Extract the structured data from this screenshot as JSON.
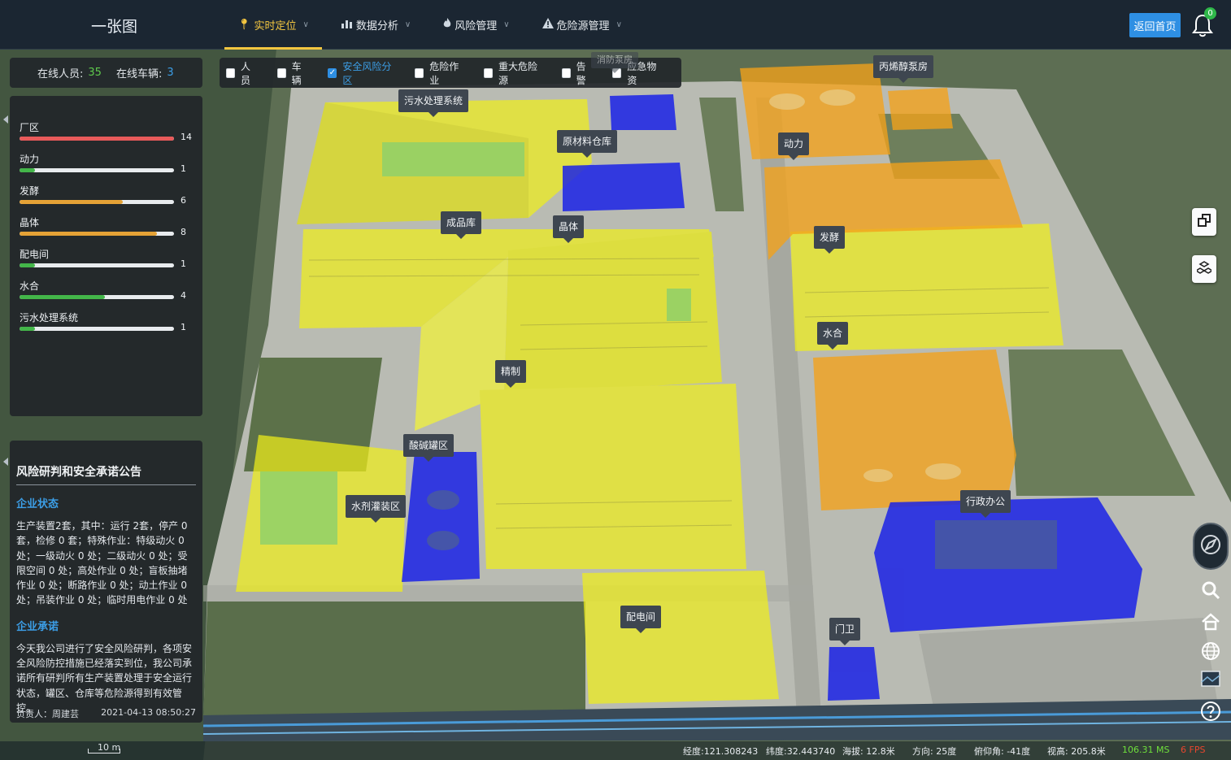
{
  "header": {
    "app_title": "一张图",
    "nav": [
      {
        "label": "实时定位",
        "active": true
      },
      {
        "label": "数据分析",
        "active": false
      },
      {
        "label": "风险管理",
        "active": false
      },
      {
        "label": "危险源管理",
        "active": false
      }
    ],
    "home_button": "返回首页",
    "notification_count": "0"
  },
  "online": {
    "staff_label": "在线人员:",
    "staff_count": "35",
    "vehicle_label": "在线车辆:",
    "vehicle_count": "3"
  },
  "filters": [
    {
      "label": "人员",
      "checked": false
    },
    {
      "label": "车辆",
      "checked": false
    },
    {
      "label": "安全风险分区",
      "checked": true
    },
    {
      "label": "危险作业",
      "checked": false
    },
    {
      "label": "重大危险源",
      "checked": false
    },
    {
      "label": "告警",
      "checked": false
    },
    {
      "label": "应急物资",
      "checked": false
    }
  ],
  "zones": [
    {
      "name": "厂区",
      "value": "14",
      "ratio": 1.0,
      "color": "#e85a5a"
    },
    {
      "name": "动力",
      "value": "1",
      "ratio": 0.1,
      "color": "#43b649"
    },
    {
      "name": "发酵",
      "value": "6",
      "ratio": 0.67,
      "color": "#e5a236"
    },
    {
      "name": "晶体",
      "value": "8",
      "ratio": 0.89,
      "color": "#e5a236"
    },
    {
      "name": "配电间",
      "value": "1",
      "ratio": 0.1,
      "color": "#43b649"
    },
    {
      "name": "水合",
      "value": "4",
      "ratio": 0.55,
      "color": "#43b649"
    },
    {
      "name": "污水处理系统",
      "value": "1",
      "ratio": 0.1,
      "color": "#43b649"
    }
  ],
  "notice": {
    "title": "风险研判和安全承诺公告",
    "status_heading": "企业状态",
    "status_text": "生产装置2套，其中：运行 2套，停产 0 套，检修 0 套；特殊作业：特级动火 0 处；一级动火 0 处；二级动火 0 处；受限空间 0 处；高处作业 0 处；盲板抽堵作业 0 处；断路作业 0 处；动土作业 0 处；吊装作业 0 处；临时用电作业 0 处",
    "promise_heading": "企业承诺",
    "promise_text": "今天我公司进行了安全风险研判，各项安全风险防控措施已经落实到位，我公司承诺所有研判所有生产装置处理于安全运行状态，罐区、仓库等危险源得到有效管控。",
    "owner": "负责人：周建芸",
    "datetime": "2021-04-13 08:50:27"
  },
  "buildings": [
    {
      "name": "污水处理系统"
    },
    {
      "name": "原材料仓库"
    },
    {
      "name": "丙烯醇泵房"
    },
    {
      "name": "消防泵房"
    },
    {
      "name": "动力"
    },
    {
      "name": "成品库"
    },
    {
      "name": "晶体"
    },
    {
      "name": "发酵"
    },
    {
      "name": "水合"
    },
    {
      "name": "精制"
    },
    {
      "name": "酸碱罐区"
    },
    {
      "name": "水剂灌装区"
    },
    {
      "name": "行政办公"
    },
    {
      "name": "配电间"
    },
    {
      "name": "门卫"
    }
  ],
  "statusbar": {
    "scale": "10 m",
    "longitude": "经度:121.308243",
    "latitude": "纬度:32.443740",
    "altitude": "海拔: 12.8米",
    "heading": "方向: 25度",
    "pitch": "俯仰角: -41度",
    "view_height": "视高: 205.8米",
    "ms": "106.31 MS",
    "fps": "6 FPS"
  },
  "colors": {
    "accent": "#f3c640",
    "primary": "#2e8fe3",
    "zone_yellow": "#f0ef1a",
    "zone_orange": "#f4a21a",
    "zone_blue": "#1a22e6"
  }
}
